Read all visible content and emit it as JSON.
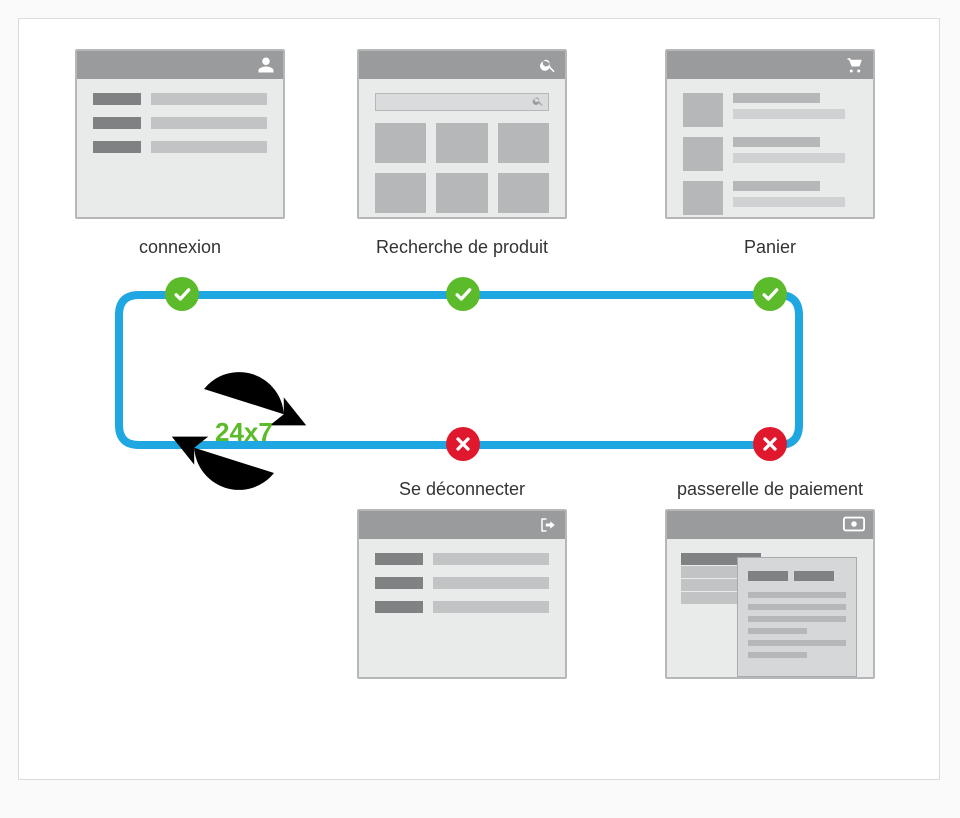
{
  "steps": {
    "login": {
      "label": "connexion",
      "status": "ok",
      "icon": "user"
    },
    "search": {
      "label": "Recherche de produit",
      "status": "ok",
      "icon": "search"
    },
    "cart": {
      "label": "Panier",
      "status": "ok",
      "icon": "cart"
    },
    "payment": {
      "label": "passerelle de paiement",
      "status": "err",
      "icon": "money"
    },
    "logout": {
      "label": "Se déconnecter",
      "status": "err",
      "icon": "signout"
    }
  },
  "cycle_label": "24x7",
  "colors": {
    "flow": "#1ea7e0",
    "ok": "#5bbb2b",
    "err": "#e0182d",
    "frame": "#b6b7b8",
    "titlebar": "#9a9b9c"
  }
}
